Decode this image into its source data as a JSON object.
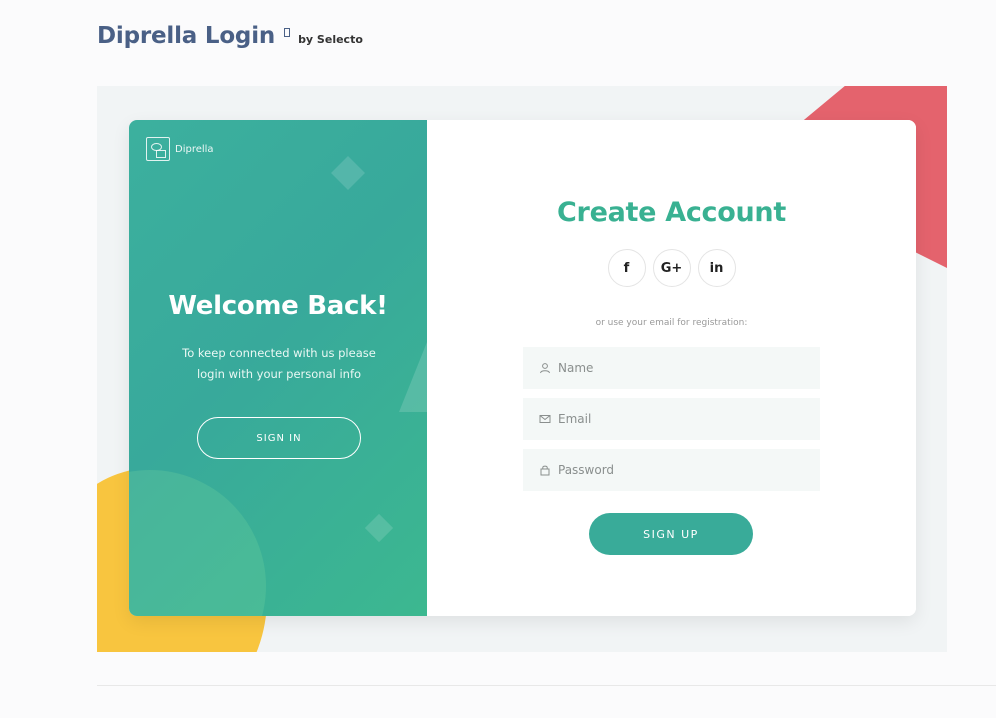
{
  "header": {
    "title": "Diprella Login",
    "by_line": "by Selecto"
  },
  "left_panel": {
    "brand_name": "Diprella",
    "welcome_title": "Welcome Back!",
    "welcome_text": "To keep connected with us please login with your personal info",
    "signin_label": "SIGN IN"
  },
  "right_panel": {
    "title": "Create Account",
    "social": [
      {
        "label": "f",
        "icon": "facebook-icon"
      },
      {
        "label": "G+",
        "icon": "google-plus-icon"
      },
      {
        "label": "in",
        "icon": "linkedin-icon"
      }
    ],
    "hint": "or use your email for registration:",
    "fields": {
      "name": {
        "placeholder": "Name",
        "value": ""
      },
      "email": {
        "placeholder": "Email",
        "value": ""
      },
      "password": {
        "placeholder": "Password",
        "value": ""
      }
    },
    "signup_label": "SIGN UP"
  },
  "colors": {
    "accent": "#39b192",
    "title_blue": "#4a6086",
    "red_shape": "#e4636d",
    "yellow_shape": "#f8c53f"
  }
}
